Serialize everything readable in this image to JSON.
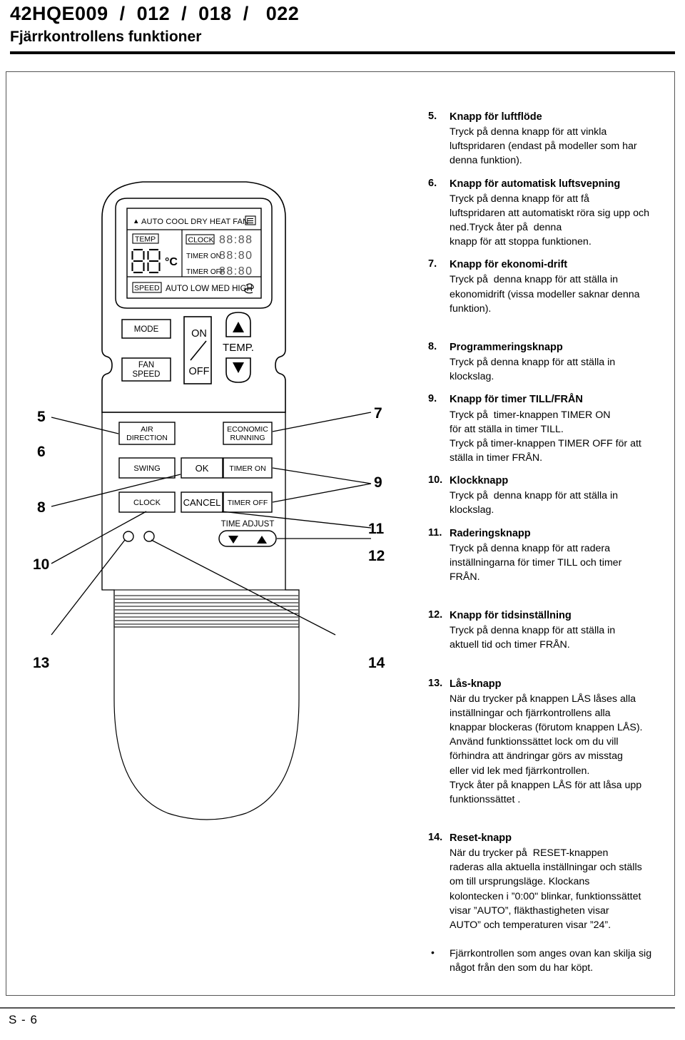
{
  "header": {
    "model_line": "42HQE009  /  012  /  018  /   022",
    "subtitle": "Fjärrkontrollens funktioner"
  },
  "footer": {
    "page_label": "S - 6"
  },
  "remote": {
    "display": {
      "mode_row": {
        "pointer": "▲",
        "modes": "AUTO COOL DRY HEAT FAN",
        "signal_icon": "transmit-icon"
      },
      "temp_label": "TEMP",
      "temp_value": "88",
      "temp_unit": "°C",
      "clock_label": "CLOCK",
      "clock_value": "88:88",
      "timer_on_label": "TIMER ON",
      "timer_on_value": "88:80",
      "timer_off_label": "TIMER OFF",
      "timer_off_value": "88:80",
      "speed_label": "SPEED",
      "speed_values": "AUTO LOW MED HIGH",
      "lock_icon": "lock-icon"
    },
    "buttons": [
      {
        "name": "mode-button",
        "label": "MODE"
      },
      {
        "name": "fan-speed-button",
        "label": "FAN\nSPEED"
      },
      {
        "name": "on-off-button",
        "label_on": "ON",
        "label_off": "OFF"
      },
      {
        "name": "temp-label",
        "label": "TEMP."
      },
      {
        "name": "temp-up-button",
        "label": "▲"
      },
      {
        "name": "temp-down-button",
        "label": "▼"
      },
      {
        "name": "air-direction-button",
        "label": "AIR\nDIRECTION"
      },
      {
        "name": "economic-running-button",
        "label": "ECONOMIC\nRUNNING"
      },
      {
        "name": "swing-button",
        "label": "SWING"
      },
      {
        "name": "ok-button",
        "label": "OK"
      },
      {
        "name": "timer-on-button",
        "label": "TIMER ON"
      },
      {
        "name": "clock-button",
        "label": "CLOCK"
      },
      {
        "name": "cancel-button",
        "label": "CANCEL"
      },
      {
        "name": "timer-off-button",
        "label": "TIMER OFF"
      },
      {
        "name": "time-adjust-label",
        "label": "TIME ADJUST"
      },
      {
        "name": "time-adjust-down-button",
        "label": "▼"
      },
      {
        "name": "time-adjust-up-button",
        "label": "▲"
      }
    ],
    "callouts_left": [
      "5",
      "6",
      "8",
      "10",
      "13"
    ],
    "callouts_right": [
      "7",
      "9",
      "11",
      "12",
      "14"
    ]
  },
  "descriptions": [
    {
      "num": "5.",
      "title": "Knapp för luftflöde",
      "lines": [
        "Tryck på denna knapp för att vinkla",
        "luftspridaren (endast på modeller som har",
        "denna funktion)."
      ]
    },
    {
      "num": "6.",
      "title": "Knapp för automatisk luftsvepning",
      "lines": [
        "Tryck på denna knapp för att få",
        "luftspridaren att automatiskt röra sig upp och",
        "ned.Tryck åter på  denna",
        "knapp för att stoppa funktionen."
      ]
    },
    {
      "num": "7.",
      "title": "Knapp för ekonomi-drift",
      "lines": [
        "Tryck på  denna knapp för att ställa in",
        "ekonomidrift (vissa modeller saknar denna",
        "funktion)."
      ]
    },
    {
      "num": "8.",
      "title": "Programmeringsknapp",
      "lines": [
        "Tryck på denna knapp för att ställa in",
        "klockslag."
      ]
    },
    {
      "num": "9.",
      "title": "Knapp för timer TILL/FRÅN",
      "lines": [
        "Tryck på  timer-knappen TIMER ON",
        "för att ställa in timer TILL.",
        "Tryck på timer-knappen TIMER OFF för att",
        "ställa in timer FRÅN."
      ]
    },
    {
      "num": "10.",
      "title": "Klockknapp",
      "lines": [
        "Tryck på  denna knapp för att ställa in",
        "klockslag."
      ]
    },
    {
      "num": "11.",
      "title": "Raderingsknapp",
      "lines": [
        "Tryck på denna knapp för att radera",
        "inställningarna för timer TILL och timer",
        "FRÅN."
      ]
    },
    {
      "num": "12.",
      "title": "Knapp för tidsinställning",
      "lines": [
        "Tryck på denna knapp för att ställa in",
        "aktuell tid och timer FRÅN."
      ]
    },
    {
      "num": "13.",
      "title": "Lås-knapp",
      "lines": [
        "När du trycker på knappen LÅS låses alla",
        "inställningar och fjärrkontrollens alla",
        "knappar blockeras (förutom knappen LÅS).",
        "Använd funktionssättet lock om du vill",
        "förhindra att ändringar görs av misstag",
        "eller vid lek med fjärrkontrollen.",
        "Tryck åter på knappen LÅS för att låsa upp",
        "funktionssättet ."
      ]
    },
    {
      "num": "14.",
      "title": "Reset-knapp",
      "lines": [
        "När du trycker på  RESET-knappen",
        "raderas alla aktuella inställningar och ställs",
        "om till ursprungsläge. Klockans",
        "kolontecken i ”0:00\" blinkar, funktionssättet",
        "visar ”AUTO”, fläkthastigheten visar",
        "AUTO” och temperaturen visar ”24”."
      ]
    }
  ],
  "note": {
    "bullet": "•",
    "lines": [
      "Fjärrkontrollen som anges ovan kan skilja sig",
      "något från den som du har köpt."
    ]
  }
}
